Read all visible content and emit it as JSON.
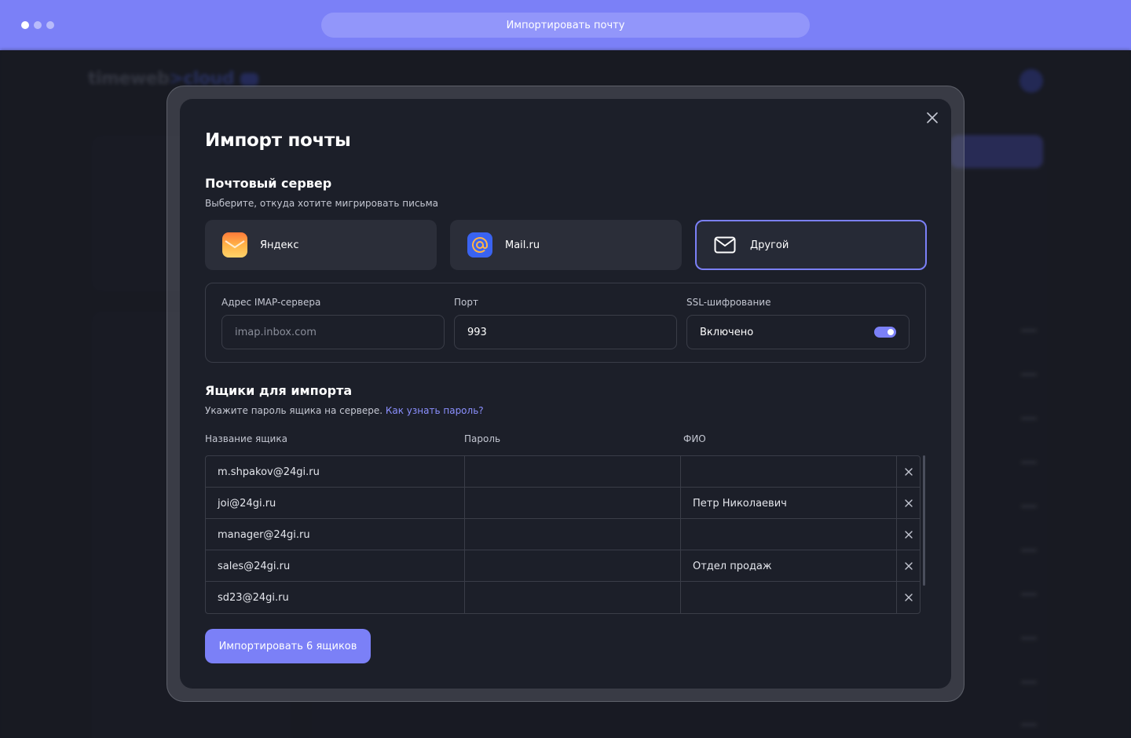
{
  "browser": {
    "url_title": "Импортировать почту"
  },
  "modal": {
    "title": "Импорт почты",
    "server_section": {
      "title": "Почтовый сервер",
      "subtitle": "Выберите, откуда хотите мигрировать письма",
      "providers": [
        {
          "label": "Яндекс",
          "icon": "yandex-mail-icon",
          "selected": false
        },
        {
          "label": "Mail.ru",
          "icon": "mailru-at-icon",
          "selected": false
        },
        {
          "label": "Другой",
          "icon": "envelope-icon",
          "selected": true
        }
      ]
    },
    "imap": {
      "address_label": "Адрес IMAP-сервера",
      "address_placeholder": "imap.inbox.com",
      "address_value": "",
      "port_label": "Порт",
      "port_value": "993",
      "ssl_label": "SSL-шифрование",
      "ssl_value": "Включено",
      "ssl_enabled": true
    },
    "mailboxes_section": {
      "title": "Ящики для импорта",
      "subtitle": "Укажите пароль ящика на сервере.",
      "link": "Как узнать пароль?",
      "columns": [
        "Название ящика",
        "Пароль",
        "ФИО"
      ],
      "rows": [
        {
          "name": "m.shpakov@24gi.ru",
          "password": "",
          "fio": ""
        },
        {
          "name": "joi@24gi.ru",
          "password": "",
          "fio": "Петр Николаевич"
        },
        {
          "name": "manager@24gi.ru",
          "password": "",
          "fio": ""
        },
        {
          "name": "sales@24gi.ru",
          "password": "",
          "fio": "Отдел продаж"
        },
        {
          "name": "sd23@24gi.ru",
          "password": "",
          "fio": ""
        }
      ]
    },
    "import_button": "Импортировать 6 ящиков"
  },
  "colors": {
    "accent": "#7b80f7",
    "modal_bg": "#1c1f29",
    "card_bg": "#2b2e39",
    "link": "#8b90ff"
  }
}
